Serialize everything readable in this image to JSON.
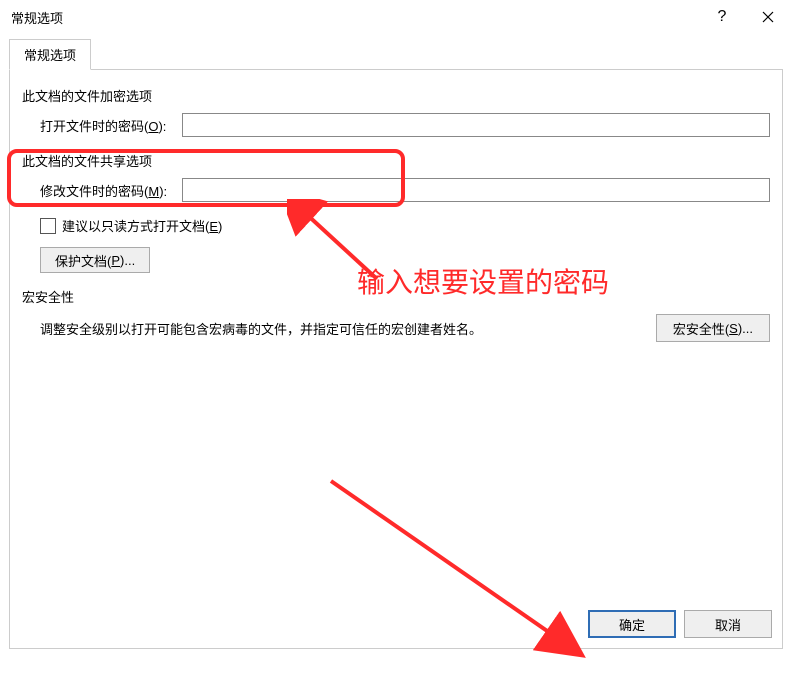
{
  "title": "常规选项",
  "tab": "常规选项",
  "section1": "此文档的文件加密选项",
  "open_pw_label_pre": "打开文件时的密码(",
  "open_pw_key": "O",
  "open_pw_label_post": "):",
  "open_pw_value": "",
  "section2": "此文档的文件共享选项",
  "mod_pw_label_pre": "修改文件时的密码(",
  "mod_pw_key": "M",
  "mod_pw_label_post": "):",
  "mod_pw_value": "",
  "readonly_pre": "建议以只读方式打开文档(",
  "readonly_key": "E",
  "readonly_post": ")",
  "readonly_checked": false,
  "protect_pre": "保护文档(",
  "protect_key": "P",
  "protect_post": ")...",
  "section3": "宏安全性",
  "macro_desc": "调整安全级别以打开可能包含宏病毒的文件，并指定可信任的宏创建者姓名。",
  "macro_btn_pre": "宏安全性(",
  "macro_btn_key": "S",
  "macro_btn_post": ")...",
  "ok": "确定",
  "cancel": "取消",
  "annotation": "输入想要设置的密码"
}
